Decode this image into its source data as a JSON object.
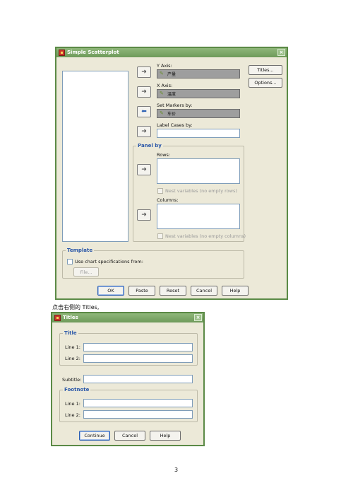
{
  "scatter_dialog": {
    "title": "Simple Scatterplot",
    "y_axis": {
      "label": "Y Axis:",
      "value": "产量"
    },
    "x_axis": {
      "label": "X Axis:",
      "value": "温度"
    },
    "set_markers": {
      "label": "Set Markers by:",
      "value": "车价"
    },
    "label_cases": {
      "label": "Label Cases by:"
    },
    "panel_by": {
      "title": "Panel by",
      "rows_label": "Rows:",
      "rows_nest": "Nest variables (no empty rows)",
      "columns_label": "Columns:",
      "columns_nest": "Nest variables (no empty columns)"
    },
    "template": {
      "title": "Template",
      "use_spec": "Use chart specifications from:",
      "file_button": "File..."
    },
    "side_buttons": {
      "titles": "Titles...",
      "options": "Options..."
    },
    "buttons": {
      "ok": "OK",
      "paste": "Paste",
      "reset": "Reset",
      "cancel": "Cancel",
      "help": "Help"
    }
  },
  "caption": "点击右侧的 Titles,",
  "titles_dialog": {
    "title": "Titles",
    "title_group": {
      "title": "Title",
      "line1": "Line 1:",
      "line2": "Line 2:"
    },
    "subtitle": "Subtitle:",
    "footnote_group": {
      "title": "Footnote",
      "line1": "Line 1:",
      "line2": "Line 2:"
    },
    "buttons": {
      "continue": "Continue",
      "cancel": "Cancel",
      "help": "Help"
    }
  },
  "page_number": "3"
}
